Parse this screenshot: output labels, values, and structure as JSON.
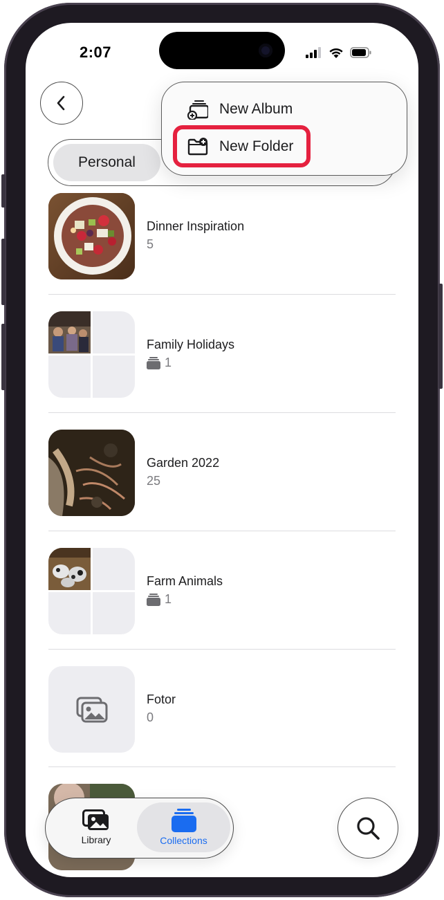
{
  "status_bar": {
    "time": "2:07"
  },
  "segments": {
    "selected": "Personal"
  },
  "menu": {
    "items": [
      {
        "label": "New Album",
        "icon": "new-album-icon"
      },
      {
        "label": "New Folder",
        "icon": "new-folder-icon"
      }
    ],
    "highlight_color": "#e5213f"
  },
  "albums": [
    {
      "title": "Dinner Inspiration",
      "count": "5",
      "kind": "album"
    },
    {
      "title": "Family Holidays",
      "count": "1",
      "kind": "folder"
    },
    {
      "title": "Garden 2022",
      "count": "25",
      "kind": "album"
    },
    {
      "title": "Farm Animals",
      "count": "1",
      "kind": "folder"
    },
    {
      "title": "Fotor",
      "count": "0",
      "kind": "empty-album"
    }
  ],
  "tabbar": {
    "library_label": "Library",
    "collections_label": "Collections",
    "active": "Collections",
    "accent": "#1a6cf0"
  }
}
